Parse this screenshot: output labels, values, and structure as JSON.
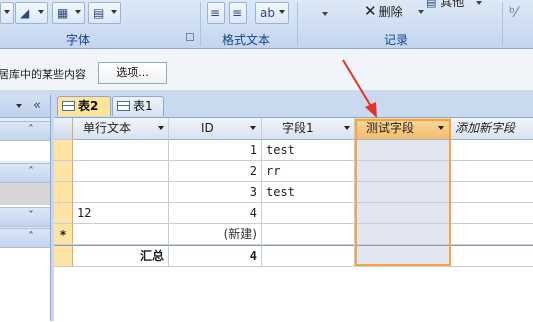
{
  "ribbon": {
    "groups": [
      {
        "label": "字体"
      },
      {
        "label": "格式文本"
      },
      {
        "label": "记录"
      }
    ],
    "records": {
      "delete_label": "删除",
      "other_label": "其他"
    }
  },
  "message_bar": {
    "text": "居库中的某些内容",
    "options_label": "选项..."
  },
  "tabs": [
    {
      "label": "表2",
      "active": true
    },
    {
      "label": "表1",
      "active": false
    }
  ],
  "datasheet": {
    "columns": [
      {
        "label": "单行文本"
      },
      {
        "label": "ID"
      },
      {
        "label": "字段1"
      },
      {
        "label": "测试字段"
      },
      {
        "label": "添加新字段"
      }
    ],
    "rows": [
      {
        "text": "",
        "id": "1",
        "field1": "test",
        "test_field": ""
      },
      {
        "text": "",
        "id": "2",
        "field1": "rr",
        "test_field": ""
      },
      {
        "text": "",
        "id": "3",
        "field1": "test",
        "test_field": ""
      },
      {
        "text": "12",
        "id": "4",
        "field1": "",
        "test_field": ""
      }
    ],
    "new_row": {
      "marker": "*",
      "id": "(新建)"
    },
    "totals": {
      "label": "汇总",
      "id": "4"
    }
  },
  "colors": {
    "selection_outline": "#f5a442",
    "arrow": "#e8302a",
    "active_tab": "#ffe49a"
  }
}
